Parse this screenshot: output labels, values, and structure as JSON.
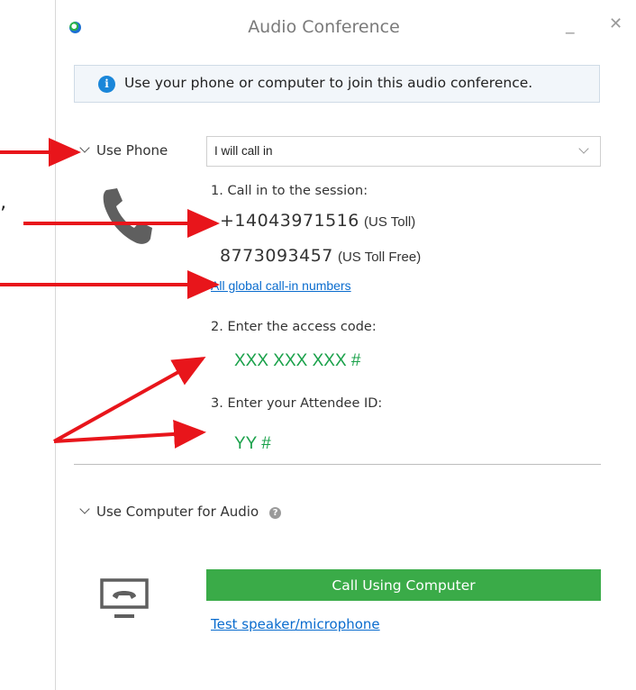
{
  "window": {
    "title": "Audio Conference"
  },
  "title_buttons": {
    "minimize": "_",
    "close": "✕"
  },
  "info": {
    "icon": "i",
    "text": "Use your phone or computer to join this audio conference."
  },
  "phone_section": {
    "toggle_label": "Use Phone",
    "select_value": "I will call in",
    "step1": "1. Call in to the session:",
    "number1": "+14043971516",
    "number1_note": "(US Toll)",
    "number2": "8773093457",
    "number2_note": "(US Toll Free)",
    "global_link": "All global call-in numbers",
    "step2": "2. Enter the access code:",
    "access_code": "XXX XXX XXX #",
    "step3": "3. Enter your Attendee ID:",
    "attendee_id": "YY #"
  },
  "computer_section": {
    "toggle_label": "Use Computer for Audio",
    "help_icon": "?",
    "call_button": "Call Using Computer",
    "test_link": "Test speaker/microphone"
  },
  "overlay": {
    "apostrophe": "’"
  },
  "colors": {
    "accent_green": "#3aab48",
    "code_green": "#1aa14a",
    "link_blue": "#0a6cce",
    "arrow_red": "#e8151b",
    "info_blue": "#1a86d9"
  }
}
